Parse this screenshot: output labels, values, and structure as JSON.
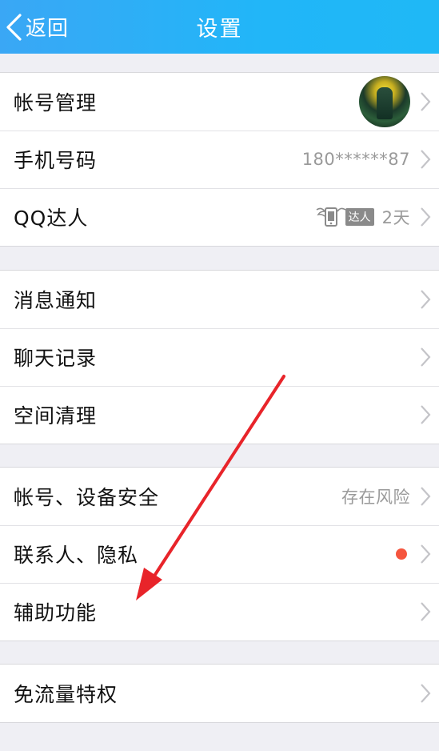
{
  "header": {
    "back_label": "返回",
    "title": "设置"
  },
  "group1": {
    "account": {
      "label": "帐号管理"
    },
    "phone": {
      "label": "手机号码",
      "value": "180******87"
    },
    "qq_daren": {
      "label": "QQ达人",
      "badge": "达人",
      "value": "2天"
    }
  },
  "group2": {
    "notify": {
      "label": "消息通知"
    },
    "chat_history": {
      "label": "聊天记录"
    },
    "space_clean": {
      "label": "空间清理"
    }
  },
  "group3": {
    "security": {
      "label": "帐号、设备安全",
      "value": "存在风险"
    },
    "contacts_privacy": {
      "label": "联系人、隐私"
    },
    "accessibility": {
      "label": "辅助功能"
    }
  },
  "group4": {
    "free_traffic": {
      "label": "免流量特权"
    }
  },
  "colors": {
    "header": "#21b6f8",
    "annotation_arrow": "#e8242a",
    "red_dot": "#f5553e"
  },
  "icons": [
    "back-chevron-icon",
    "chevron-right-icon",
    "avatar",
    "daren-wing-phone-icon"
  ]
}
